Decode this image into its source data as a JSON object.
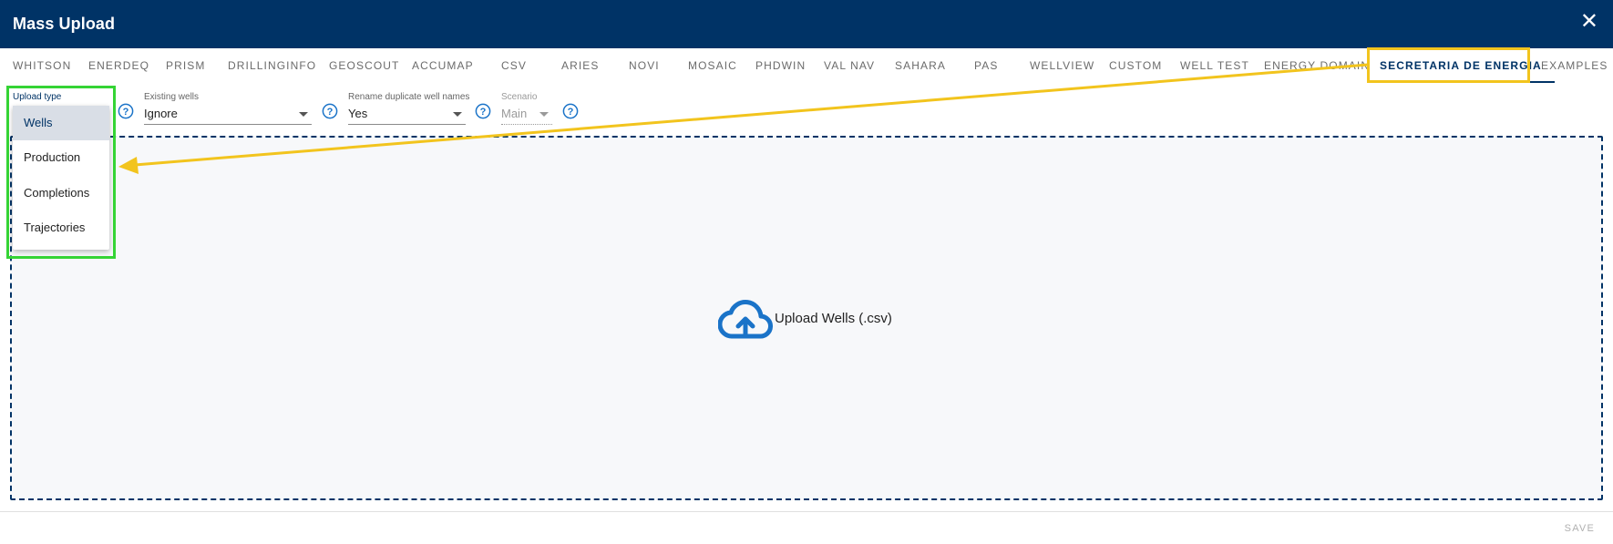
{
  "dialog": {
    "title": "Mass Upload"
  },
  "tabs": [
    {
      "label": "WHITSON"
    },
    {
      "label": "ENERDEQ"
    },
    {
      "label": "PRISM"
    },
    {
      "label": "DRILLINGINFO"
    },
    {
      "label": "GEOSCOUT"
    },
    {
      "label": "ACCUMAP"
    },
    {
      "label": "CSV"
    },
    {
      "label": "ARIES"
    },
    {
      "label": "NOVI"
    },
    {
      "label": "MOSAIC"
    },
    {
      "label": "PHDWIN"
    },
    {
      "label": "VAL NAV"
    },
    {
      "label": "SAHARA"
    },
    {
      "label": "PAS"
    },
    {
      "label": "WELLVIEW"
    },
    {
      "label": "CUSTOM"
    },
    {
      "label": "WELL TEST"
    },
    {
      "label": "ENERGY DOMAIN"
    },
    {
      "label": "SECRETARIA DE ENERGIA"
    },
    {
      "label": "EXAMPLES"
    }
  ],
  "active_tab": "SECRETARIA DE ENERGIA",
  "fields": {
    "upload_type": {
      "label": "Upload type"
    },
    "existing_wells": {
      "label": "Existing wells",
      "value": "Ignore"
    },
    "rename_duplicates": {
      "label": "Rename duplicate well names",
      "value": "Yes"
    },
    "scenario": {
      "label": "Scenario",
      "value": "Main"
    }
  },
  "upload_type_menu": {
    "items": [
      "Wells",
      "Production",
      "Completions",
      "Trajectories"
    ],
    "selected": "Wells"
  },
  "dropzone": {
    "text": "Upload Wells (.csv)"
  },
  "footer": {
    "save_label": "SAVE"
  },
  "colors": {
    "brand": "#003366",
    "icon_blue": "#1a73c8",
    "highlight_green": "#35d435",
    "highlight_yellow": "#f2c41d"
  }
}
